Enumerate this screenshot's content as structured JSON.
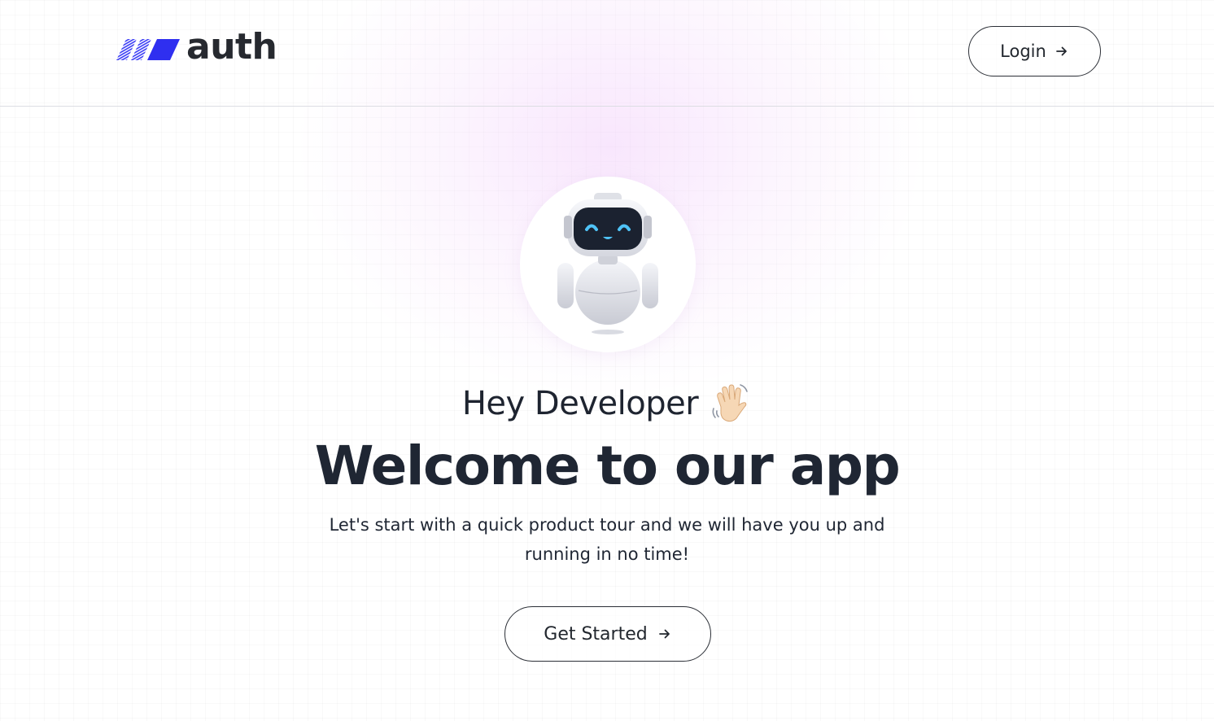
{
  "brand": {
    "name": "auth",
    "accent": "#3b3df5",
    "icon": "slanted-bars-logo-icon"
  },
  "header": {
    "login_label": "Login",
    "login_icon": "arrow-right-icon"
  },
  "hero": {
    "avatar_icon": "robot-icon",
    "greeting": "Hey Developer",
    "greeting_icon": "waving-hand-icon",
    "headline": "Welcome to our app",
    "subtitle": "Let's start with a quick product tour and we will have you up and running in no time!",
    "cta_label": "Get Started",
    "cta_icon": "arrow-right-icon"
  },
  "colors": {
    "text": "#1f2633",
    "border": "#2b2f36",
    "glow": "#f3d6fa",
    "robot_screen": "#1b2230",
    "robot_eyes": "#4fc3f7"
  }
}
